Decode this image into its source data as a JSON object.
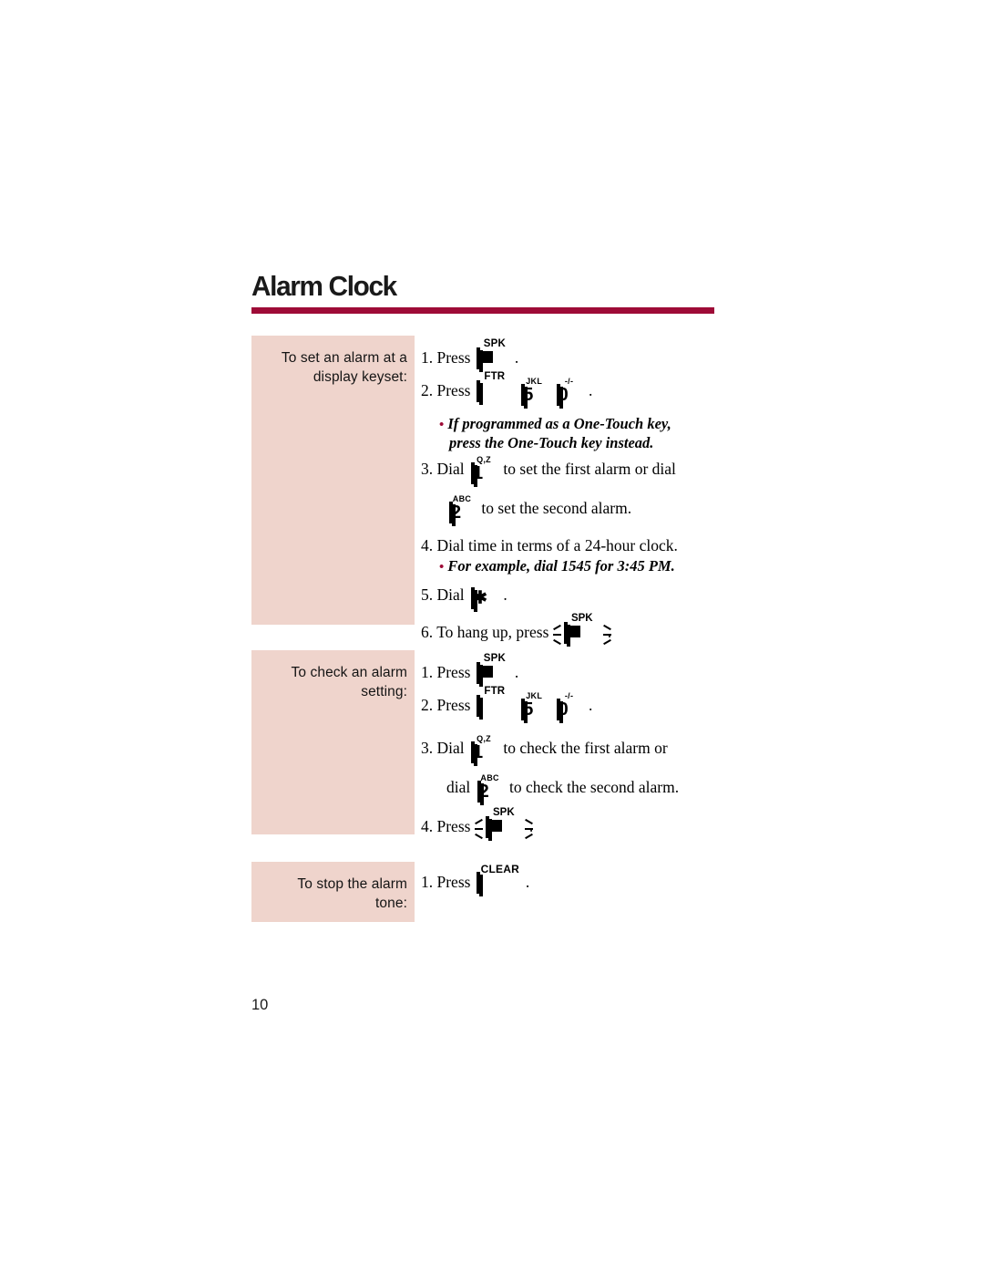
{
  "document": {
    "title": "Alarm Clock",
    "page_number": "10",
    "accent_color": "#9e0b37",
    "sidebar_color": "#efd4cc"
  },
  "keys": {
    "spk": {
      "cap": "SPK",
      "glyph": "",
      "name": "spk-key"
    },
    "spk_lit": {
      "cap": "SPK",
      "glyph": "",
      "name": "spk-key-lit"
    },
    "ftr": {
      "cap": "FTR",
      "glyph": "",
      "name": "ftr-key"
    },
    "clear": {
      "cap": "CLEAR",
      "glyph": "",
      "name": "clear-key"
    },
    "five": {
      "cap": "JKL",
      "glyph": "5",
      "name": "dialpad-key-5"
    },
    "zero": {
      "cap": "-/-",
      "glyph": "0",
      "name": "dialpad-key-0"
    },
    "one": {
      "cap": "Q,Z",
      "glyph": "1",
      "name": "dialpad-key-1"
    },
    "two": {
      "cap": "ABC",
      "glyph": "2",
      "name": "dialpad-key-2"
    },
    "star": {
      "cap": "",
      "glyph": "✱",
      "name": "dialpad-key-star"
    }
  },
  "sections": [
    {
      "id": "set-alarm",
      "label": "To set an alarm at a display keyset:",
      "label_line1": "To set an alarm at a",
      "label_line2": "display keyset:",
      "steps": {
        "s1_num": "1.",
        "s1_verb": "Press",
        "s1_end": ".",
        "s2_num": "2.",
        "s2_verb": "Press",
        "s2_end": ".",
        "note1_bullet": "•",
        "note1_line1": "If programmed as a One-Touch key,",
        "note1_line2": "press the One-Touch key instead.",
        "s3_num": "3.",
        "s3_verb": "Dial",
        "s3_mid": "to set the first alarm or dial",
        "s3_tail": "to set the second alarm.",
        "s4_num": "4.",
        "s4_text": "Dial time in terms of a 24-hour clock.",
        "note2_bullet": "•",
        "note2_text": "For example, dial 1545 for 3:45 PM.",
        "s5_num": "5.",
        "s5_verb": "Dial",
        "s5_end": ".",
        "s6_num": "6.",
        "s6_verb": "To hang up, press",
        "s6_end": "."
      }
    },
    {
      "id": "check-alarm",
      "label": "To check an alarm setting:",
      "label_line1": "To check an alarm",
      "label_line2": "setting:",
      "steps": {
        "s1_num": "1.",
        "s1_verb": "Press",
        "s1_end": ".",
        "s2_num": "2.",
        "s2_verb": "Press",
        "s2_end": ".",
        "s3_num": "3.",
        "s3_verb": "Dial",
        "s3_mid": "to check the first alarm or",
        "s3_verb2": "dial",
        "s3_tail": "to check the second alarm.",
        "s4_num": "4.",
        "s4_verb": "Press",
        "s4_end": "."
      }
    },
    {
      "id": "stop-tone",
      "label": "To stop the alarm tone:",
      "label_line1": "To stop the alarm",
      "label_line2": "tone:",
      "steps": {
        "s1_num": "1.",
        "s1_verb": "Press",
        "s1_end": "."
      }
    }
  ]
}
